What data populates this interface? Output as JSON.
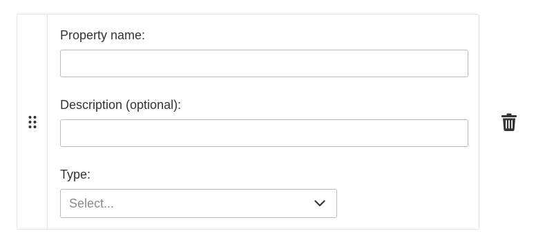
{
  "property": {
    "name_label": "Property name:",
    "name_value": "",
    "description_label": "Description (optional):",
    "description_value": "",
    "type_label": "Type:",
    "type_placeholder": "Select..."
  },
  "icons": {
    "drag_handle": "drag-handle-icon",
    "delete": "trash-icon",
    "dropdown": "chevron-down-icon"
  },
  "colors": {
    "text": "#333333",
    "placeholder": "#8a8a8a",
    "border": "#b8b8b8",
    "card_border": "#e3e3e3",
    "icon": "#333333"
  }
}
